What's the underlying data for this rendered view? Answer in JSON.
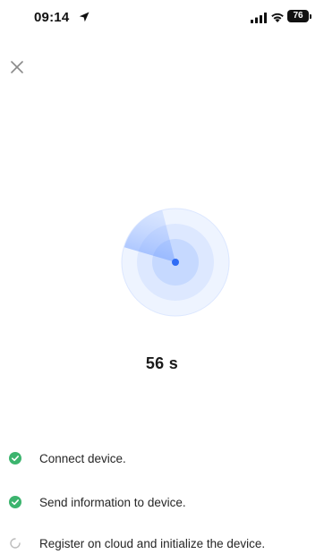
{
  "status_bar": {
    "time": "09:14",
    "battery_level": "76",
    "icons": [
      "location-arrow-icon",
      "cellular-signal-icon",
      "wifi-icon",
      "battery-icon"
    ]
  },
  "header": {
    "close_icon": "close-icon"
  },
  "progress": {
    "countdown": "56 s"
  },
  "steps": [
    {
      "label": "Connect device.",
      "status": "done",
      "icon": "check-circle-icon"
    },
    {
      "label": "Send information to device.",
      "status": "done",
      "icon": "check-circle-icon"
    },
    {
      "label": "Register on cloud and initialize the device.",
      "status": "in-progress",
      "icon": "loading-spinner-icon"
    }
  ],
  "colors": {
    "success": "#3cb46e",
    "accent": "#2f72ff",
    "radar_light": "#e6efff",
    "radar_mid": "#c8daff",
    "spinner": "#bcbcbc"
  }
}
